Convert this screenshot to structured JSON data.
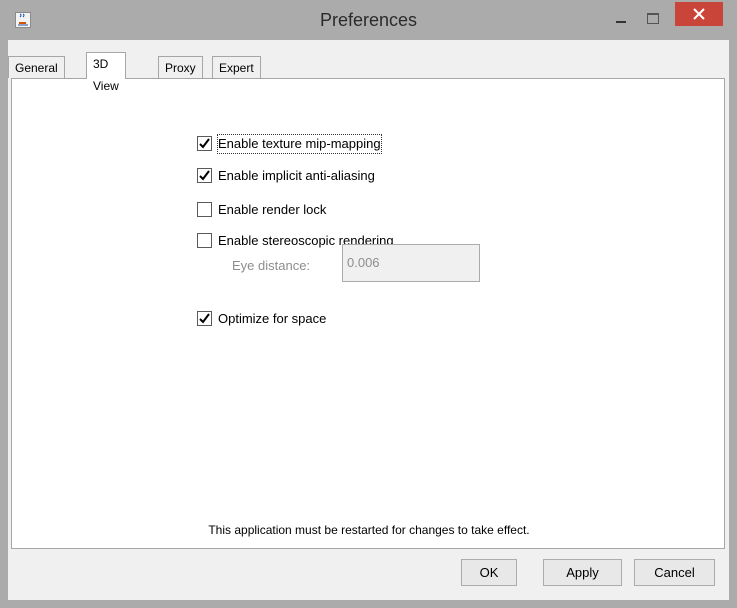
{
  "window": {
    "title": "Preferences",
    "icon": "java-cup-icon",
    "close_color": "#c9453a"
  },
  "tabs": [
    {
      "label": "General",
      "active": false
    },
    {
      "label": "3D View",
      "active": true
    },
    {
      "label": "Proxy",
      "active": false
    },
    {
      "label": "Expert",
      "active": false
    }
  ],
  "options": [
    {
      "label": "Enable texture mip-mapping",
      "checked": true
    },
    {
      "label": "Enable implicit anti-aliasing",
      "checked": true
    },
    {
      "label": "Enable render lock",
      "checked": false
    },
    {
      "label": "Enable stereoscopic rendering",
      "checked": false
    },
    {
      "label": "Optimize for space",
      "checked": true
    }
  ],
  "eye_distance": {
    "label": "Eye distance:",
    "value": "0.006",
    "enabled": false
  },
  "notice": "This application must be restarted for changes to take effect.",
  "buttons": {
    "ok": "OK",
    "apply": "Apply",
    "cancel": "Cancel"
  }
}
